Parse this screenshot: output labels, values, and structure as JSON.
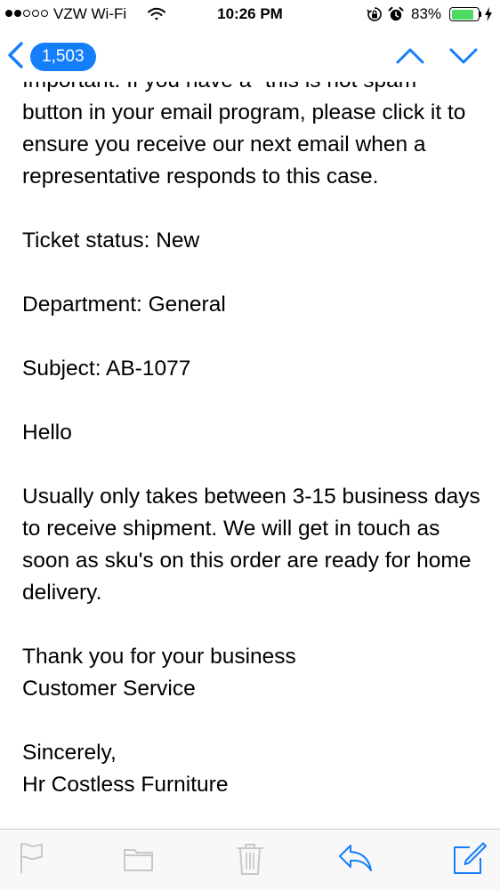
{
  "status_bar": {
    "carrier": "VZW Wi-Fi",
    "time": "10:26 PM",
    "battery_percent": "83%",
    "battery_level": 0.83,
    "signal_bars": 2
  },
  "nav": {
    "back_count": "1,503"
  },
  "message": {
    "paragraphs": [
      "Important: If you have a \"this is not spam\" button in your email program, please click it to ensure you receive our next email when a representative responds to this case.",
      "Ticket status: New",
      "Department: General",
      "Subject: AB-1077",
      "Hello",
      "Usually only takes between 3-15 business days to receive shipment. We will get in touch as soon as sku's on this order are ready for home delivery.",
      "Thank you for your business\nCustomer Service",
      "Sincerely,\nHr Costless Furniture"
    ]
  },
  "colors": {
    "accent": "#147efb",
    "toolbar_icon_disabled": "#c7c7cc",
    "battery": "#4cd964"
  },
  "icons": {
    "toolbar": [
      "flag-icon",
      "folder-icon",
      "trash-icon",
      "reply-icon",
      "compose-icon"
    ]
  }
}
